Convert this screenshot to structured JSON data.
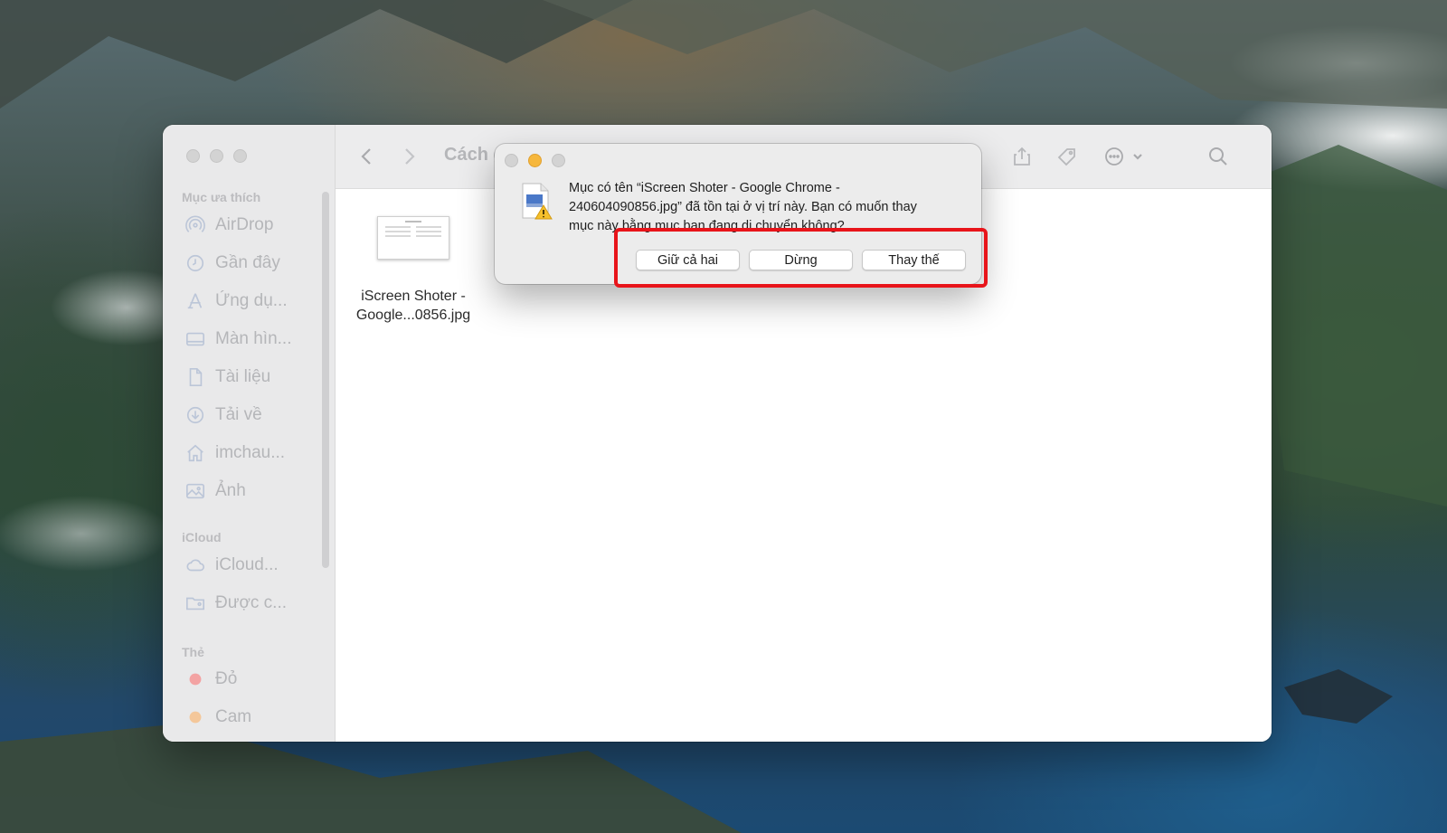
{
  "colors": {
    "accent_highlight": "#e8141a",
    "traffic_minimize": "#f6b73c",
    "tag_red": "#f3a3a3",
    "tag_orange": "#f4c79a"
  },
  "finder": {
    "toolbar": {
      "folder_title": "Cách g",
      "back_icon": "chevron-left-icon",
      "forward_icon": "chevron-right-icon",
      "share_icon": "share-icon",
      "tag_icon": "tag-icon",
      "more_icon": "ellipsis-circle-icon",
      "search_icon": "search-icon"
    },
    "sidebar": {
      "favorites_title": "Mục ưa thích",
      "favorites": [
        {
          "label": "AirDrop",
          "icon": "airdrop-icon"
        },
        {
          "label": "Gần đây",
          "icon": "clock-icon"
        },
        {
          "label": "Ứng dụ...",
          "icon": "applications-icon"
        },
        {
          "label": "Màn hìn...",
          "icon": "desktop-icon"
        },
        {
          "label": "Tài liệu",
          "icon": "document-icon"
        },
        {
          "label": "Tải về",
          "icon": "download-icon"
        },
        {
          "label": "imchau...",
          "icon": "home-icon"
        },
        {
          "label": "Ảnh",
          "icon": "photo-icon"
        }
      ],
      "icloud_title": "iCloud",
      "icloud": [
        {
          "label": "iCloud...",
          "icon": "cloud-icon"
        },
        {
          "label": "Được c...",
          "icon": "shared-folder-icon"
        }
      ],
      "tags_title": "Thẻ",
      "tags": [
        {
          "label": "Đỏ",
          "color": "#f3a3a3"
        },
        {
          "label": "Cam",
          "color": "#f4c79a"
        }
      ]
    },
    "files": [
      {
        "name_line1": "iScreen Shoter -",
        "name_line2": "Google...0856.jpg"
      }
    ]
  },
  "dialog": {
    "icon": "file-warning-icon",
    "message_line1": "Mục có tên “iScreen Shoter - Google Chrome -",
    "message_line2": "240604090856.jpg” đã tồn tại ở vị trí này. Bạn có muốn thay",
    "message_line3": "mục này bằng mục bạn đang di chuyển không?",
    "buttons": {
      "keep_both": "Giữ cả hai",
      "stop": "Dừng",
      "replace": "Thay thế"
    }
  }
}
